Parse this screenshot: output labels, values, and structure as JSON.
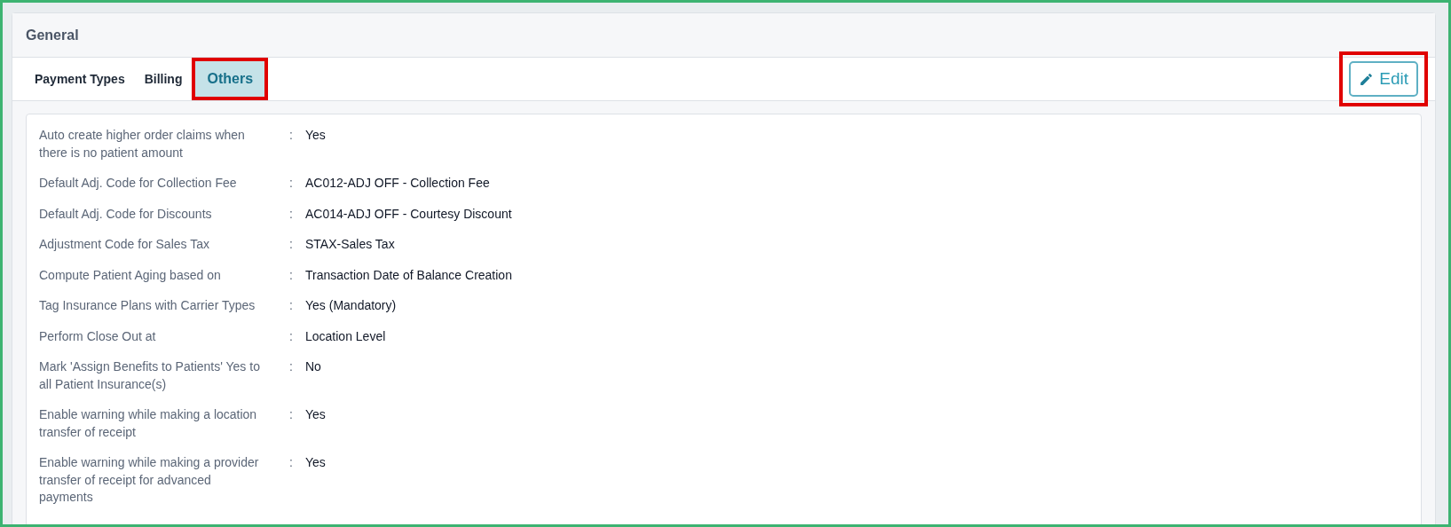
{
  "panel": {
    "title": "General"
  },
  "tabs": [
    {
      "label": "Payment Types",
      "selected": false,
      "highlighted": false
    },
    {
      "label": "Billing",
      "selected": false,
      "highlighted": false
    },
    {
      "label": "Others",
      "selected": true,
      "highlighted": true
    }
  ],
  "edit_button": {
    "label": "Edit",
    "highlighted": true
  },
  "settings": [
    {
      "label": "Auto create higher order claims when there is no patient amount",
      "separator": ":",
      "value": "Yes"
    },
    {
      "label": "Default Adj. Code for Collection Fee",
      "separator": ":",
      "value": "AC012-ADJ OFF - Collection Fee"
    },
    {
      "label": "Default Adj. Code for Discounts",
      "separator": ":",
      "value": "AC014-ADJ OFF - Courtesy Discount"
    },
    {
      "label": "Adjustment Code for Sales Tax",
      "separator": ":",
      "value": "STAX-Sales Tax"
    },
    {
      "label": "Compute Patient Aging based on",
      "separator": ":",
      "value": "Transaction Date of Balance Creation"
    },
    {
      "label": "Tag Insurance Plans with Carrier Types",
      "separator": ":",
      "value": "Yes (Mandatory)"
    },
    {
      "label": "Perform Close Out at",
      "separator": ":",
      "value": "Location Level"
    },
    {
      "label": "Mark 'Assign Benefits to Patients' Yes to all Patient Insurance(s)",
      "separator": ":",
      "value": "No"
    },
    {
      "label": "Enable warning while making a location transfer of receipt",
      "separator": ":",
      "value": "Yes"
    },
    {
      "label": "Enable warning while making a provider transfer of receipt for advanced payments",
      "separator": ":",
      "value": "Yes"
    }
  ]
}
